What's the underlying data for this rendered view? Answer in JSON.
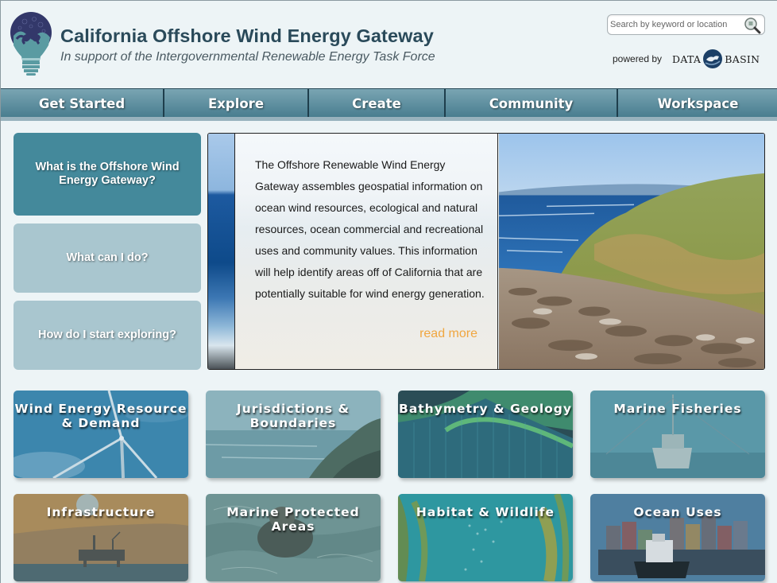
{
  "header": {
    "title": "California Offshore Wind Energy Gateway",
    "subtitle": "In support of the Intergovernmental Renewable Energy Task Force",
    "search": {
      "placeholder": "Search by keyword or location",
      "value": ""
    },
    "powered_by": "powered by",
    "partner": {
      "left": "DATA",
      "right": "BASIN"
    }
  },
  "nav": {
    "items": [
      {
        "label": "Get Started"
      },
      {
        "label": "Explore"
      },
      {
        "label": "Create"
      },
      {
        "label": "Community"
      },
      {
        "label": "Workspace"
      }
    ]
  },
  "questions": [
    {
      "label": "What is the Offshore Wind Energy Gateway?",
      "active": true
    },
    {
      "label": "What can I do?",
      "active": false
    },
    {
      "label": "How do I start exploring?",
      "active": false
    }
  ],
  "hero": {
    "text": "The Offshore Renewable Wind Energy Gateway assembles geospatial information on ocean wind resources, ecological and natural resources, ocean commercial and recreational uses and community values. This information will help identify areas off of California that are potentially suitable for wind energy generation.",
    "read_more": "read more"
  },
  "tiles": [
    {
      "label": "Wind Energy Resource & Demand"
    },
    {
      "label": "Jurisdictions & Boundaries"
    },
    {
      "label": "Bathymetry & Geology"
    },
    {
      "label": "Marine Fisheries"
    },
    {
      "label": "Infrastructure"
    },
    {
      "label": "Marine Protected Areas"
    },
    {
      "label": "Habitat & Wildlife"
    },
    {
      "label": "Ocean Uses"
    }
  ],
  "colors": {
    "title": "#2a4a5a",
    "nav_top": "#7aa5b3",
    "nav_bottom": "#477c8e",
    "active_question": "#44899b",
    "idle_question": "#a9c6cf",
    "read_more": "#f0a640",
    "page_bg": "#edf4f6"
  }
}
